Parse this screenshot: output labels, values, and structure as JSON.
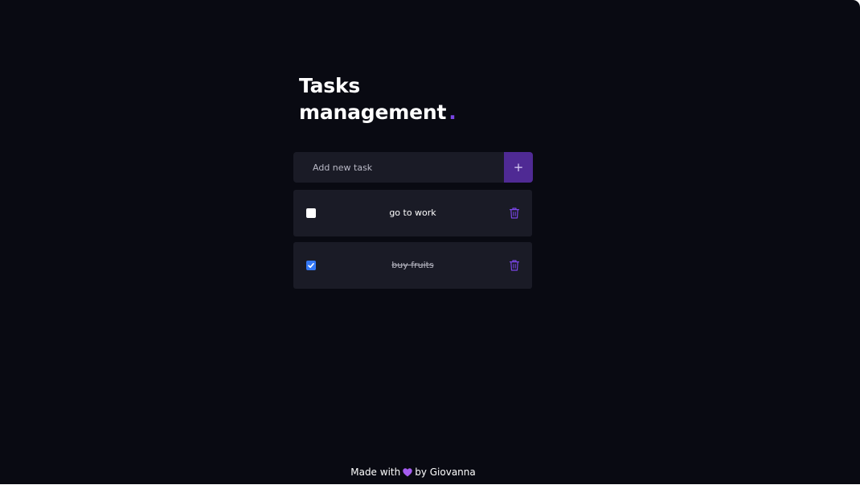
{
  "app": {
    "title_line1": "Tasks",
    "title_line2": "management",
    "title_dot": ".",
    "accent_color": "#7a45e6"
  },
  "new_task": {
    "placeholder": "Add new task",
    "value": "",
    "add_label": "+"
  },
  "tasks": [
    {
      "text": "go to work",
      "completed": false,
      "delete_icon": "trash-icon"
    },
    {
      "text": "buy fruits",
      "completed": true,
      "delete_icon": "trash-icon"
    }
  ],
  "footer": {
    "prefix": "Made with",
    "heart_icon": "purple-heart-icon",
    "suffix": "by Giovanna"
  },
  "colors": {
    "background": "#090a12",
    "card": "#1a1b26",
    "add_button": "#4f2a94",
    "checkbox_checked": "#3478f6"
  }
}
